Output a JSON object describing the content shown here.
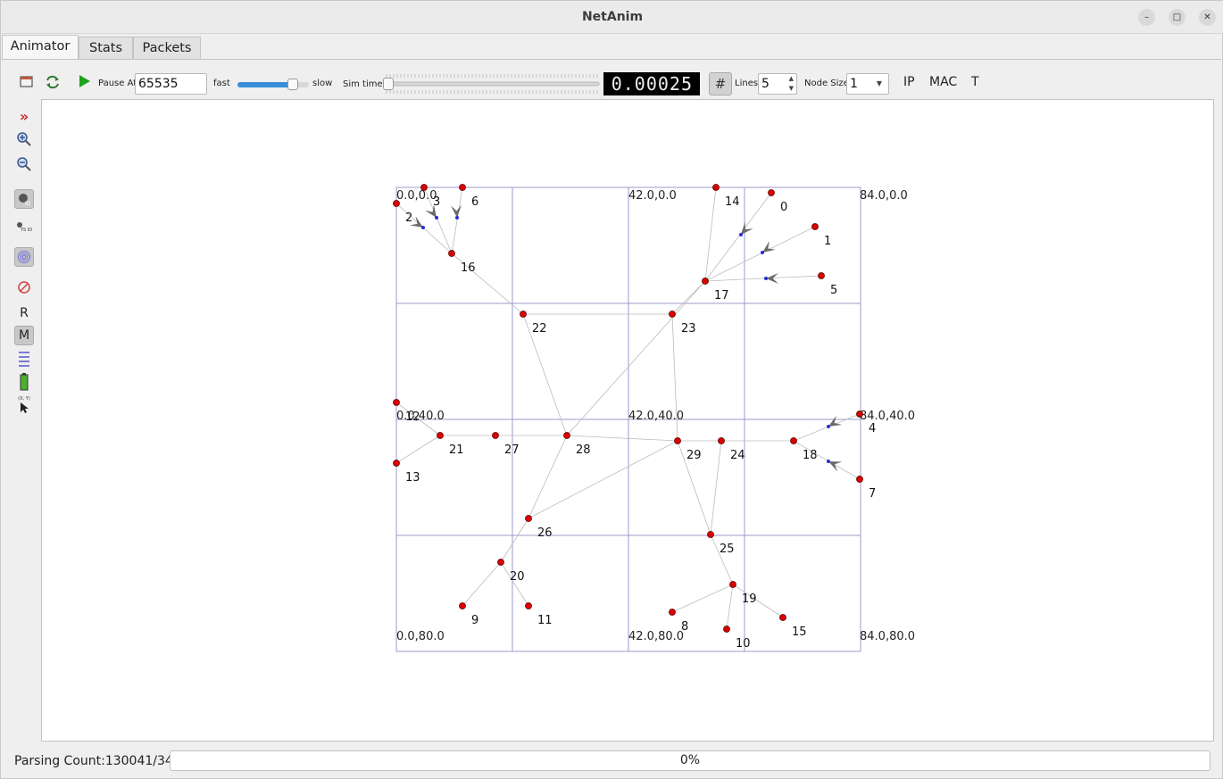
{
  "window": {
    "title": "NetAnim"
  },
  "tabs": [
    {
      "label": "Animator",
      "active": true
    },
    {
      "label": "Stats",
      "active": false
    },
    {
      "label": "Packets",
      "active": false
    }
  ],
  "toolbar": {
    "pause_at_label": "Pause At",
    "pause_at_value": "65535",
    "fast_label": "fast",
    "slow_label": "slow",
    "speed_position": 0.78,
    "sim_time_label": "Sim time",
    "sim_time_position": 0.0,
    "lcd_value": "0.00025",
    "lines_label": "Lines",
    "lines_value": "5",
    "node_size_label": "Node Size",
    "node_size_value": "1",
    "ip_label": "IP",
    "mac_label": "MAC",
    "t_label": "T"
  },
  "leftbar": {
    "r_label": "R",
    "m_label": "M",
    "xy_label": "(X, Y)"
  },
  "grid_labels": [
    "0.0,0.0",
    "42.0,0.0",
    "84.0,0.0",
    "0.0,40.0",
    "42.0,40.0",
    "84.0,40.0",
    "0.0,80.0",
    "42.0,80.0",
    "84.0,80.0"
  ],
  "nodes": [
    "0",
    "1",
    "2",
    "3",
    "4",
    "5",
    "6",
    "7",
    "8",
    "9",
    "10",
    "11",
    "12",
    "13",
    "14",
    "15",
    "16",
    "17",
    "18",
    "19",
    "20",
    "21",
    "22",
    "23",
    "24",
    "25",
    "26",
    "27",
    "28",
    "29"
  ],
  "status": {
    "parsing": "Parsing Count:130041/34",
    "progress": "0%"
  },
  "colors": {
    "node": "#dd0000",
    "grid": "#9b9bcf",
    "link": "#bcbcbc",
    "accent": "#3a8ed8"
  }
}
